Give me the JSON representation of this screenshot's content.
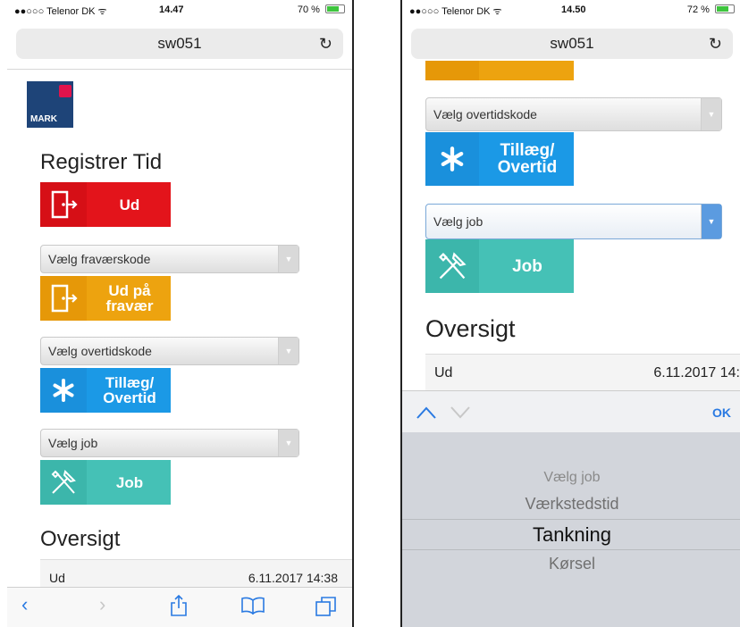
{
  "left": {
    "status": {
      "carrier": "●●○○○ Telenor DK ᯤ",
      "time": "14.47",
      "battery": "70 %",
      "battery_level": 0.7
    },
    "url": "sw051",
    "logo_text": "MARK",
    "title": "Registrer Tid",
    "btn_out": "Ud",
    "absence_select": "Vælg fraværskode",
    "btn_absence_line1": "Ud på",
    "btn_absence_line2": "fravær",
    "overtime_select": "Vælg overtidskode",
    "btn_overtime_line1": "Tillæg/",
    "btn_overtime_line2": "Overtid",
    "job_select": "Vælg job",
    "btn_job": "Job",
    "overview_title": "Oversigt",
    "overview_row": {
      "label": "Ud",
      "timestamp": "6.11.2017 14:38"
    }
  },
  "right": {
    "status": {
      "carrier": "●●○○○ Telenor DK ᯤ",
      "time": "14.50",
      "battery": "72 %",
      "battery_level": 0.72
    },
    "url": "sw051",
    "overtime_select": "Vælg overtidskode",
    "btn_overtime_line1": "Tillæg/",
    "btn_overtime_line2": "Overtid",
    "job_select": "Vælg job",
    "btn_job": "Job",
    "overview_title": "Oversigt",
    "overview_row": {
      "label": "Ud",
      "timestamp": "6.11.2017 14:"
    },
    "keyboard_ok": "OK",
    "picker_options": [
      "Vælg job",
      "Værkstedstid",
      "Tankning",
      "Kørsel"
    ],
    "picker_selected": "Tankning"
  },
  "icons": {
    "reload": "reload-icon",
    "door": "door-exit-icon",
    "asterisk": "asterisk-icon",
    "tools": "tools-icon"
  },
  "colors": {
    "red": "#e3141b",
    "orange": "#eda30f",
    "blue": "#1b99e6",
    "teal": "#45c1b6",
    "accent": "#2a7ae2"
  }
}
